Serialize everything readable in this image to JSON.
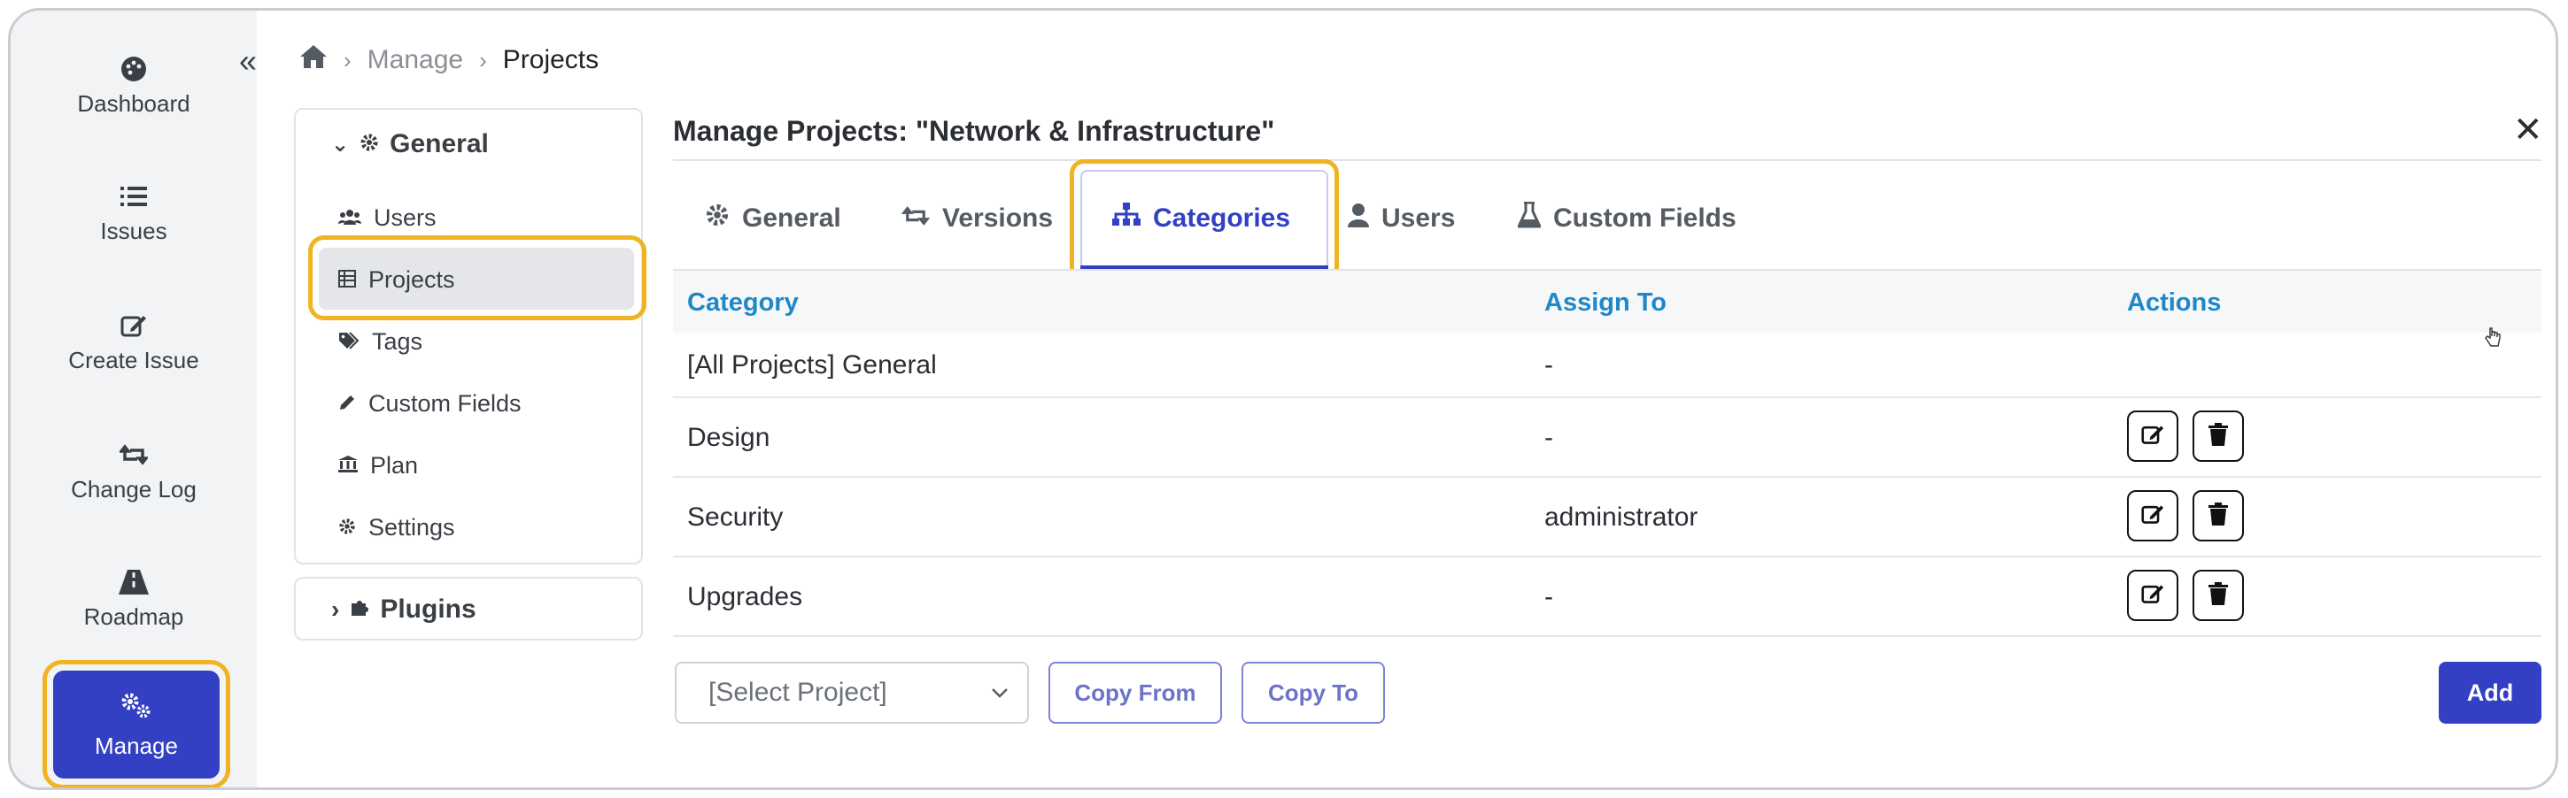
{
  "rail": {
    "items": [
      {
        "label": "Dashboard",
        "icon": "palette-icon"
      },
      {
        "label": "Issues",
        "icon": "list-icon"
      },
      {
        "label": "Create Issue",
        "icon": "edit-icon"
      },
      {
        "label": "Change Log",
        "icon": "retweet-icon"
      },
      {
        "label": "Roadmap",
        "icon": "road-icon"
      },
      {
        "label": "Manage",
        "icon": "gears-icon"
      }
    ],
    "collapse_icon": "double-chevron-left-icon"
  },
  "breadcrumb": {
    "home_icon": "home-icon",
    "items": [
      "Manage",
      "Projects"
    ]
  },
  "settings_nav": {
    "general_label": "General",
    "items": [
      {
        "label": "Users",
        "icon": "users-icon"
      },
      {
        "label": "Projects",
        "icon": "table-icon"
      },
      {
        "label": "Tags",
        "icon": "tags-icon"
      },
      {
        "label": "Custom Fields",
        "icon": "pencil-icon"
      },
      {
        "label": "Plan",
        "icon": "bank-icon"
      },
      {
        "label": "Settings",
        "icon": "gear-icon"
      }
    ],
    "plugins_label": "Plugins"
  },
  "main": {
    "title": "Manage Projects: \"Network & Infrastructure\"",
    "tabs": [
      {
        "label": "General",
        "icon": "gear-icon"
      },
      {
        "label": "Versions",
        "icon": "retweet-icon"
      },
      {
        "label": "Categories",
        "icon": "sitemap-icon"
      },
      {
        "label": "Users",
        "icon": "user-icon"
      },
      {
        "label": "Custom Fields",
        "icon": "flask-icon"
      }
    ],
    "active_tab": "Categories",
    "table": {
      "headers": [
        "Category",
        "Assign To",
        "Actions"
      ],
      "rows": [
        {
          "category": "[All Projects] General",
          "assign_to": "-"
        },
        {
          "category": "Design",
          "assign_to": "-"
        },
        {
          "category": "Security",
          "assign_to": "administrator"
        },
        {
          "category": "Upgrades",
          "assign_to": "-"
        }
      ]
    },
    "select_placeholder": "[Select Project]",
    "copy_from_label": "Copy From",
    "copy_to_label": "Copy To",
    "add_label": "Add"
  },
  "colors": {
    "accent": "#3340c4",
    "highlight": "#f0b323",
    "header_text": "#1e88c8"
  }
}
